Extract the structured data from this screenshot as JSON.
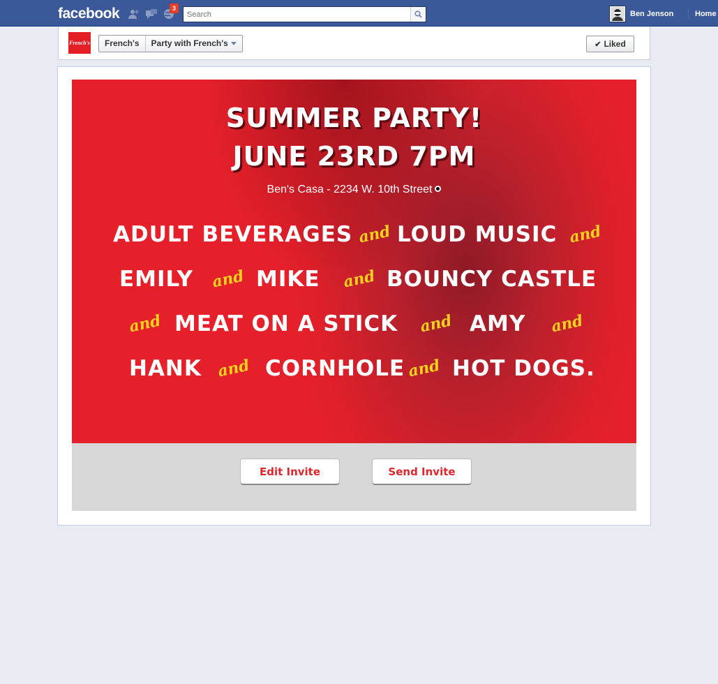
{
  "topbar": {
    "logo": "facebook",
    "notification_count": "3",
    "search_placeholder": "Search",
    "user_name": "Ben Jenson",
    "home_label": "Home"
  },
  "page_header": {
    "logo_text": "French's",
    "breadcrumb_page": "French's",
    "breadcrumb_app": "Party with French's",
    "liked_label": "Liked"
  },
  "invite": {
    "title_line1": "Summer Party!",
    "title_line2": "June 23rd 7PM",
    "address": "Ben's Casa - 2234 W. 10th Street",
    "connector": "and",
    "items": {
      "item1": "Adult Beverages",
      "item2": "Loud Music",
      "item3": "Emily",
      "item4": "Mike",
      "item5": "Bouncy Castle",
      "item6": "Meat on a Stick",
      "item7": "Amy",
      "item8": "Hank",
      "item9": "Cornhole",
      "item10": "Hot Dogs."
    }
  },
  "buttons": {
    "edit": "Edit Invite",
    "send": "Send Invite"
  },
  "colors": {
    "facebook_blue": "#3b5998",
    "poster_red": "#e6202a",
    "and_yellow": "#f7d21c",
    "button_text_red": "#e0262d"
  }
}
